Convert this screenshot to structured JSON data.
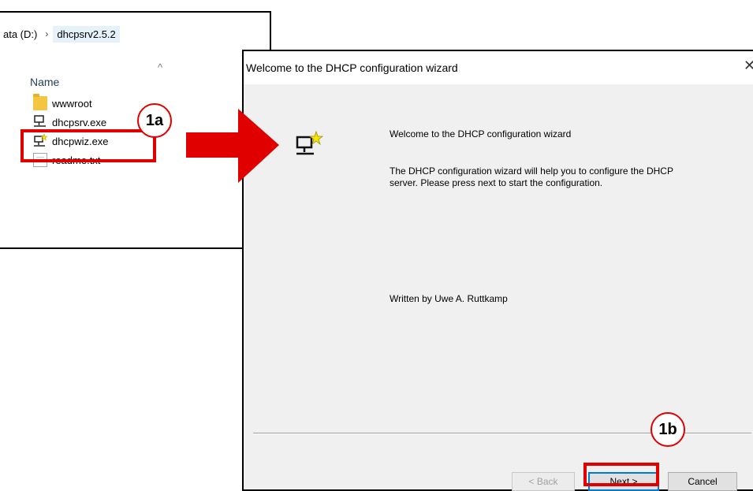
{
  "explorer": {
    "breadcrumb": [
      "ata (D:)",
      "dhcpsrv2.5.2"
    ],
    "breadcrumb_separator": "›",
    "column_header": "Name",
    "files": [
      {
        "name": "wwwroot",
        "icon": "folder-icon"
      },
      {
        "name": "dhcpsrv.exe",
        "icon": "network-computer-icon"
      },
      {
        "name": "dhcpwiz.exe",
        "icon": "wizard-computer-icon"
      },
      {
        "name": "readme.txt",
        "icon": "text-file-icon"
      }
    ]
  },
  "wizard": {
    "title": "Welcome to the DHCP configuration wizard",
    "heading": "Welcome to the DHCP configuration wizard",
    "description": "The DHCP configuration wizard will help you to configure the DHCP server. Please press next to start the configuration.",
    "author": "Written by Uwe A. Ruttkamp",
    "buttons": {
      "back": "< Back",
      "next": "Next >",
      "cancel": "Cancel"
    },
    "close_glyph": "✕"
  },
  "annotations": {
    "step_a": "1a",
    "step_b": "1b",
    "accent_color": "#e00000"
  }
}
